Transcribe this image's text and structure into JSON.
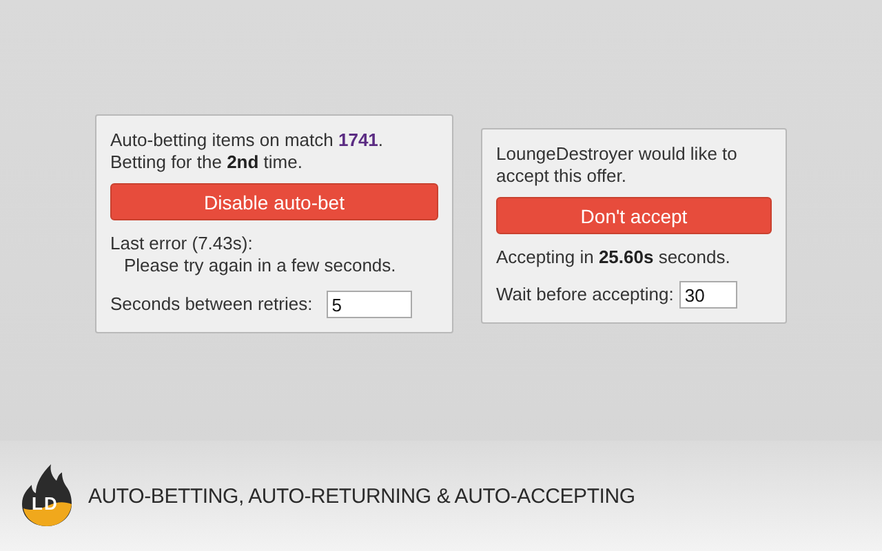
{
  "bet_panel": {
    "status_lines": [
      "Auto-betting items on match **1741**.",
      "Betting for the **2nd** time."
    ],
    "button": "Disable auto-bet",
    "error_label": "Last error (7.43s):",
    "error_message": "Please try again in a few seconds.",
    "retry_label": "Seconds between retries:",
    "retry_value": "5"
  },
  "accept_panel": {
    "message": "LoungeDestroyer would like to accept this offer.",
    "button": "Don't accept",
    "countdown": "Accepting in **25.60s** seconds.",
    "wait_label": "Wait before accepting:",
    "wait_value": "30"
  },
  "footer": {
    "logo": "LD",
    "tagline": "AUTO-BETTING, AUTO-RETURNING & AUTO-ACCEPTING"
  }
}
